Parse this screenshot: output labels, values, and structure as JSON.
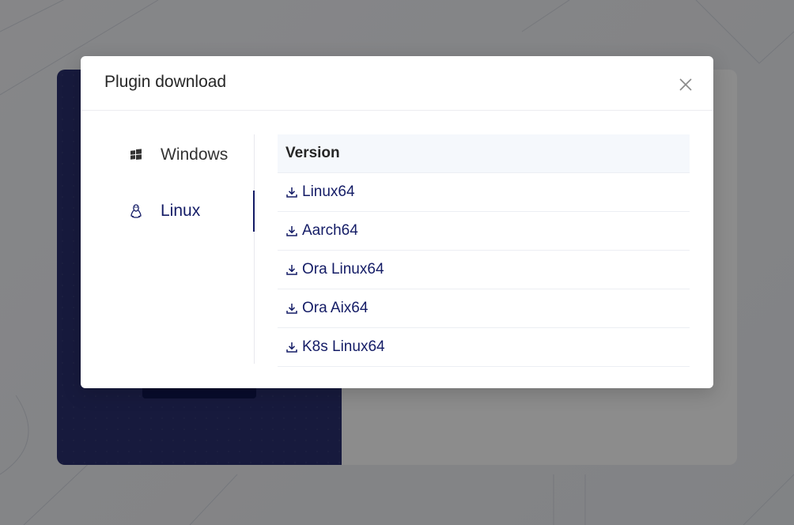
{
  "modal": {
    "title": "Plugin download",
    "close_icon": "close-icon"
  },
  "os_tabs": [
    {
      "label": "Windows",
      "icon": "windows-icon",
      "active": false
    },
    {
      "label": "Linux",
      "icon": "linux-icon",
      "active": true
    }
  ],
  "table": {
    "header": "Version",
    "rows": [
      {
        "label": "Linux64",
        "icon": "download-icon"
      },
      {
        "label": "Aarch64",
        "icon": "download-icon"
      },
      {
        "label": "Ora Linux64",
        "icon": "download-icon"
      },
      {
        "label": "Ora Aix64",
        "icon": "download-icon"
      },
      {
        "label": "K8s Linux64",
        "icon": "download-icon"
      }
    ]
  },
  "colors": {
    "accent": "#141c66",
    "mask": "rgba(0,0,0,0.45)",
    "table_header_bg": "#f5f8fc"
  }
}
